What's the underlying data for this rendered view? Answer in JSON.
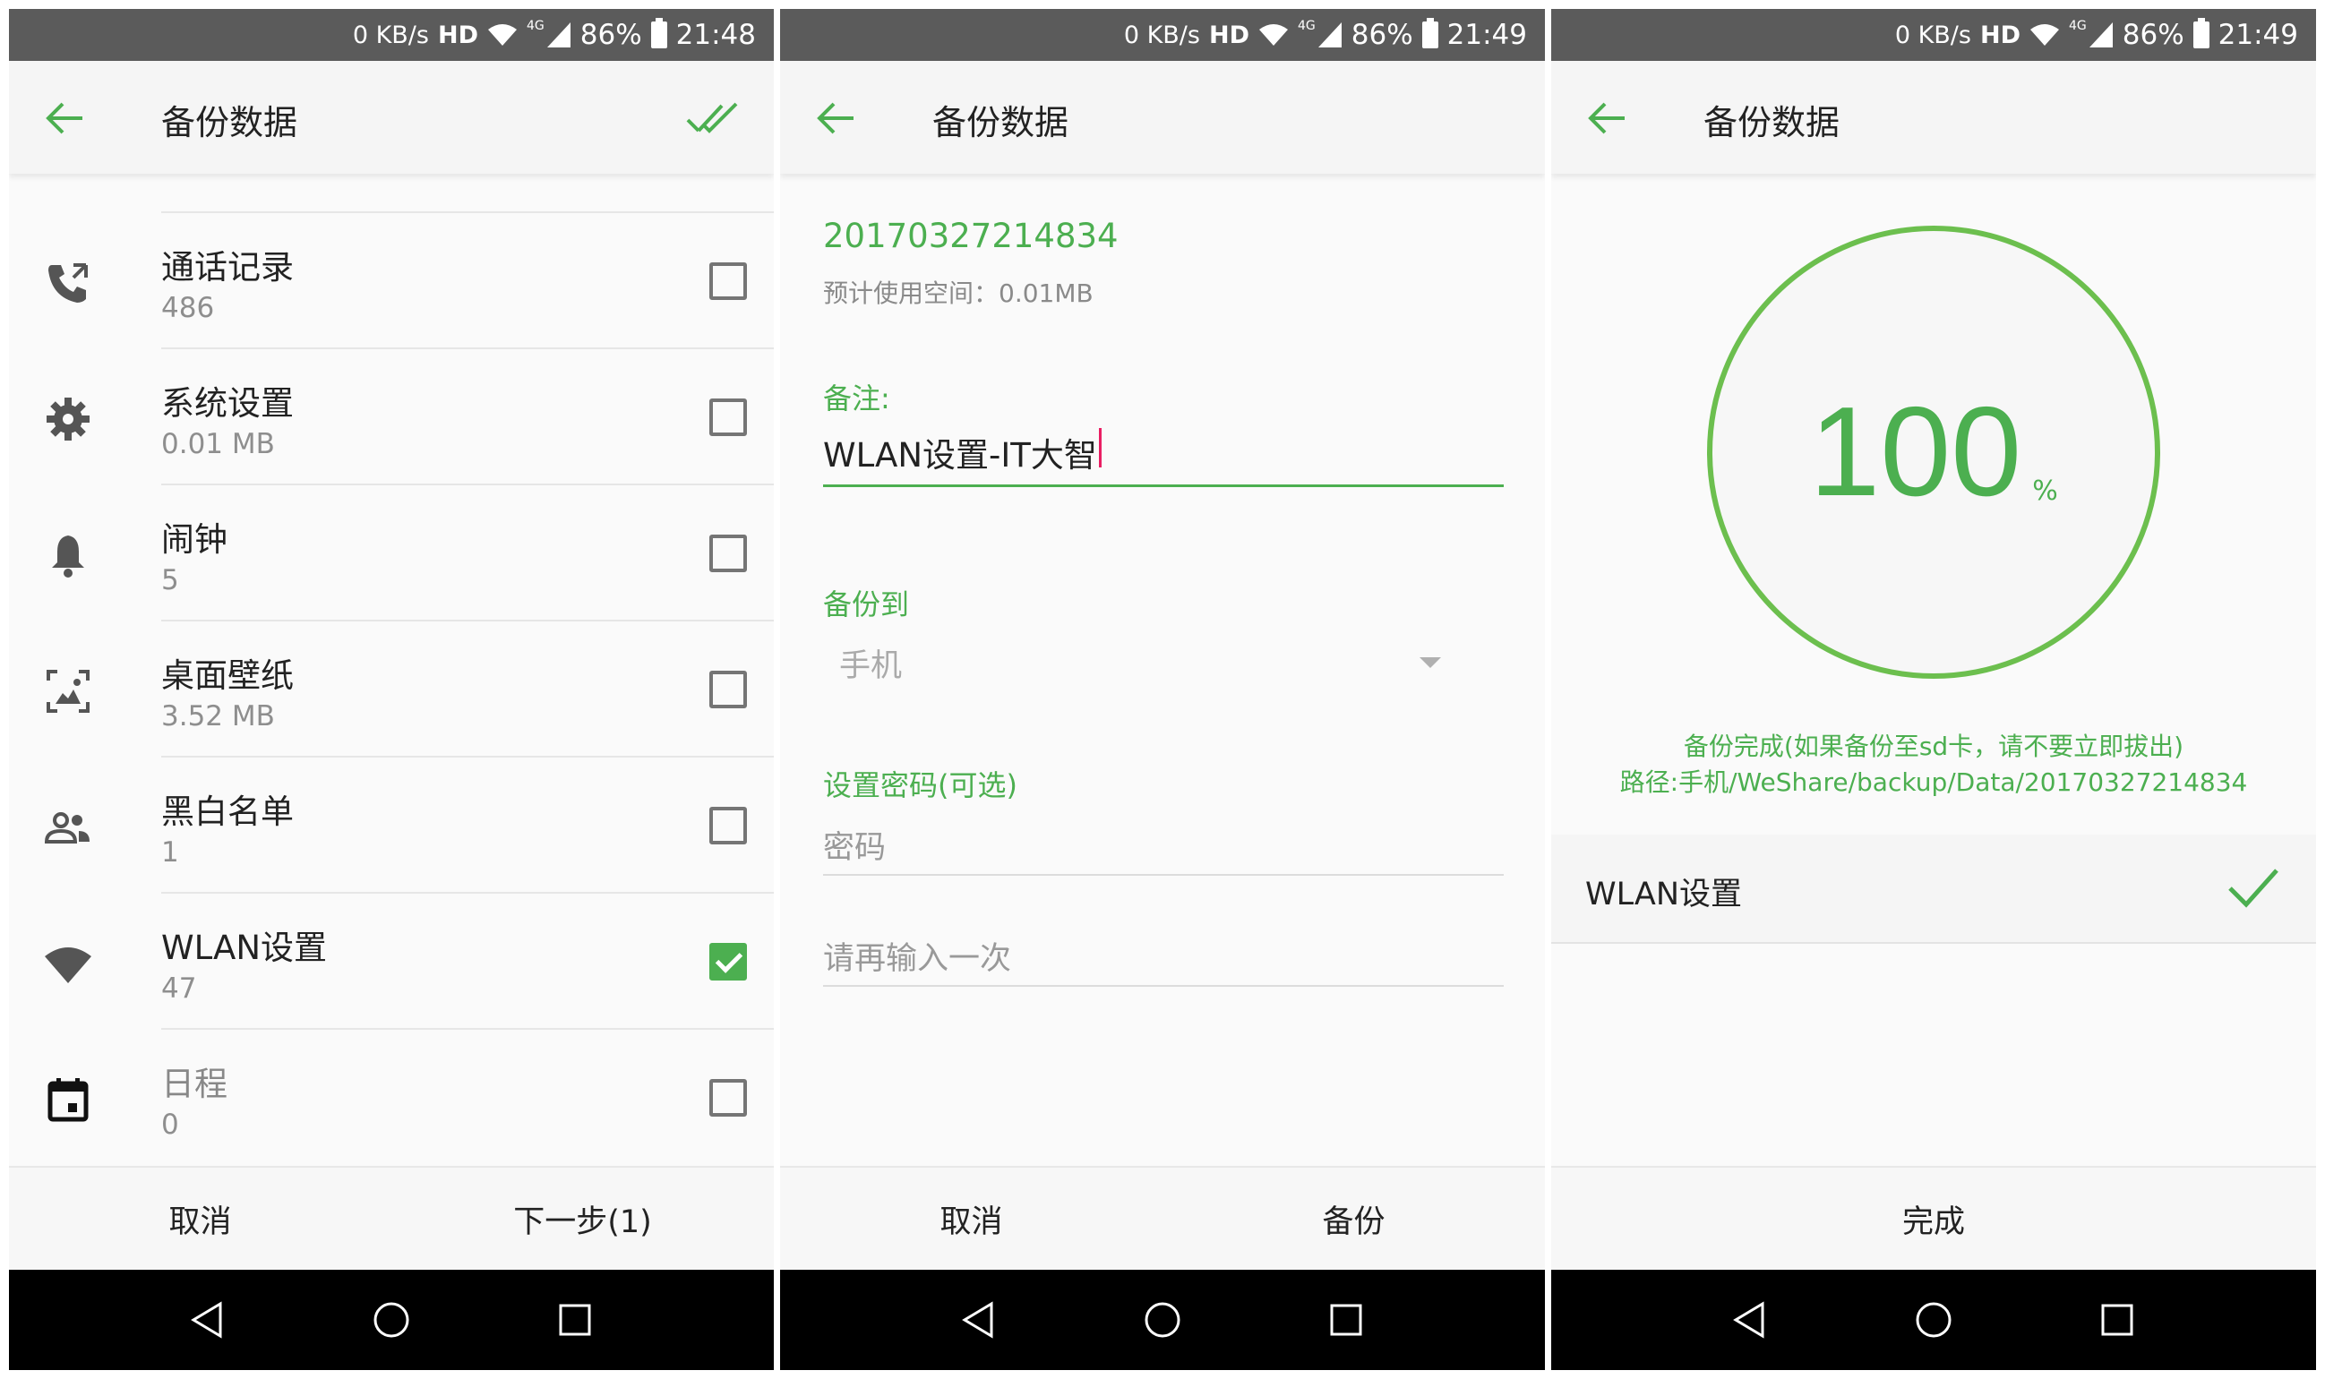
{
  "accent_color": "#4caf50",
  "status_bars": [
    {
      "speed": "0 KB/s",
      "hd": "HD",
      "network": "4G",
      "battery": "86%",
      "time": "21:48"
    },
    {
      "speed": "0 KB/s",
      "hd": "HD",
      "network": "4G",
      "battery": "86%",
      "time": "21:49"
    },
    {
      "speed": "0 KB/s",
      "hd": "HD",
      "network": "4G",
      "battery": "86%",
      "time": "21:49"
    }
  ],
  "app_title": "备份数据",
  "screen1": {
    "items": [
      {
        "name": "通话记录",
        "count": "486",
        "icon": "phone-icon",
        "checked": false
      },
      {
        "name": "系统设置",
        "count": "0.01 MB",
        "icon": "gear-icon",
        "checked": false
      },
      {
        "name": "闹钟",
        "count": "5",
        "icon": "bell-icon",
        "checked": false
      },
      {
        "name": "桌面壁纸",
        "count": "3.52 MB",
        "icon": "wallpaper-icon",
        "checked": false
      },
      {
        "name": "黑白名单",
        "count": "1",
        "icon": "people-icon",
        "checked": false
      },
      {
        "name": "WLAN设置",
        "count": "47",
        "icon": "wifi-icon",
        "checked": true
      },
      {
        "name": "日程",
        "count": "0",
        "icon": "calendar-icon",
        "checked": false
      }
    ],
    "cancel": "取消",
    "next": "下一步(1)"
  },
  "screen2": {
    "backup_id": "20170327214834",
    "est_space": "预计使用空间：0.01MB",
    "note_label": "备注:",
    "note_value": "WLAN设置-IT大智",
    "backup_to_label": "备份到",
    "backup_to_value": "手机",
    "password_label": "设置密码(可选)",
    "password_placeholder": "密码",
    "password_confirm_placeholder": "请再输入一次",
    "cancel": "取消",
    "backup": "备份"
  },
  "screen3": {
    "progress": 100,
    "progress_text": "100",
    "percent_sign": "%",
    "done_msg": "备份完成(如果备份至sd卡，请不要立即拔出)",
    "done_path": "路径:手机/WeShare/backup/Data/20170327214834",
    "result_item": "WLAN设置",
    "finish": "完成"
  }
}
